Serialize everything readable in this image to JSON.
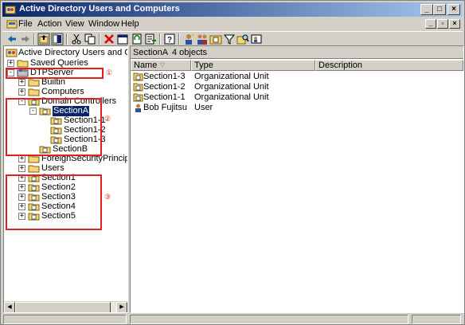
{
  "window": {
    "title": "Active Directory Users and Computers",
    "controls": [
      "_",
      "□",
      "×"
    ],
    "mdi_controls": [
      "_",
      "▫",
      "×"
    ]
  },
  "menu": {
    "items": [
      "File",
      "Action",
      "View",
      "Window",
      "Help"
    ]
  },
  "tree": {
    "root": "Active Directory Users and Computer",
    "nodes": [
      {
        "label": "Saved Queries",
        "level": 1,
        "expander": "+",
        "icon": "folder-icon"
      },
      {
        "label": "DTPServer",
        "level": 1,
        "expander": "-",
        "icon": "domain-icon"
      },
      {
        "label": "Builtin",
        "level": 2,
        "expander": "+",
        "icon": "folder-icon"
      },
      {
        "label": "Computers",
        "level": 2,
        "expander": "+",
        "icon": "folder-icon"
      },
      {
        "label": "Domain Controllers",
        "level": 2,
        "expander": "-",
        "icon": "ou-icon"
      },
      {
        "label": "SectionA",
        "level": 3,
        "expander": "-",
        "icon": "ou-icon",
        "selected": true
      },
      {
        "label": "Section1-1",
        "level": 4,
        "expander": "",
        "icon": "ou-icon"
      },
      {
        "label": "Section1-2",
        "level": 4,
        "expander": "",
        "icon": "ou-icon"
      },
      {
        "label": "Section1-3",
        "level": 4,
        "expander": "",
        "icon": "ou-icon"
      },
      {
        "label": "SectionB",
        "level": 3,
        "expander": "",
        "icon": "ou-icon"
      },
      {
        "label": "ForeignSecurityPrincipals",
        "level": 2,
        "expander": "+",
        "icon": "folder-icon"
      },
      {
        "label": "Users",
        "level": 2,
        "expander": "+",
        "icon": "folder-icon"
      },
      {
        "label": "Section1",
        "level": 2,
        "expander": "+",
        "icon": "ou-icon"
      },
      {
        "label": "Section2",
        "level": 2,
        "expander": "+",
        "icon": "ou-icon"
      },
      {
        "label": "Section3",
        "level": 2,
        "expander": "+",
        "icon": "ou-icon"
      },
      {
        "label": "Section4",
        "level": 2,
        "expander": "+",
        "icon": "ou-icon"
      },
      {
        "label": "Section5",
        "level": 2,
        "expander": "+",
        "icon": "ou-icon"
      }
    ]
  },
  "annotations": [
    "①",
    "②",
    "③"
  ],
  "right": {
    "location": "SectionA",
    "count": "4 objects",
    "columns": [
      "Name",
      "Type",
      "Description"
    ],
    "sort_indicator": "▽",
    "rows": [
      {
        "name": "Section1-3",
        "type": "Organizational Unit",
        "icon": "ou-icon"
      },
      {
        "name": "Section1-2",
        "type": "Organizational Unit",
        "icon": "ou-icon"
      },
      {
        "name": "Section1-1",
        "type": "Organizational Unit",
        "icon": "ou-icon"
      },
      {
        "name": "Bob Fujitsu",
        "type": "User",
        "icon": "user-icon"
      }
    ]
  },
  "colors": {
    "accent": "#0a246a",
    "annotation": "#e0201c",
    "folder": "#f3d67a",
    "chrome": "#d4d0c8"
  }
}
